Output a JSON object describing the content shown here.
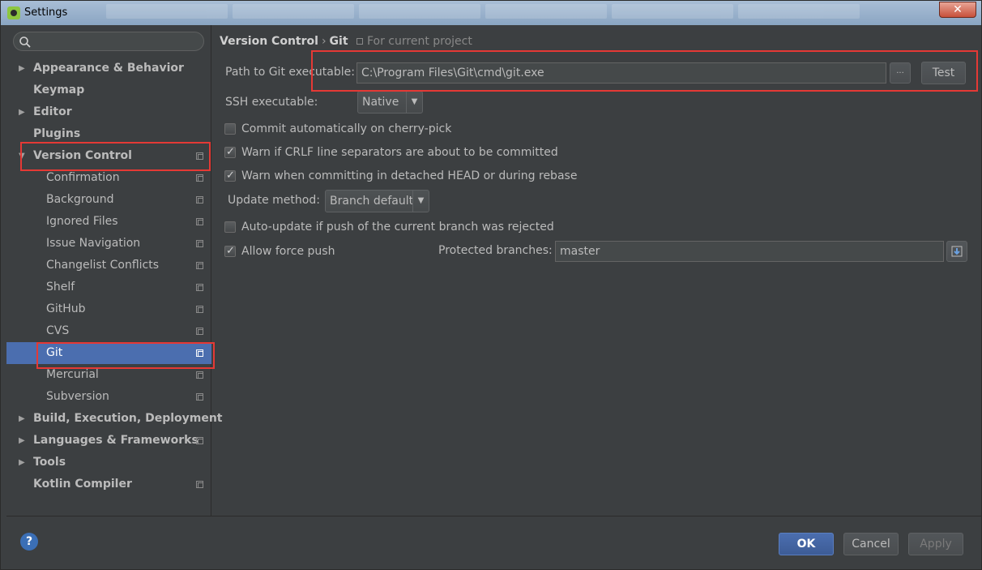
{
  "window": {
    "title": "Settings",
    "close_label": "✕"
  },
  "search": {
    "value": "",
    "placeholder": ""
  },
  "sidebar": {
    "items": [
      {
        "label": "Appearance & Behavior",
        "expandable": true,
        "expanded": false,
        "project": false
      },
      {
        "label": "Keymap",
        "expandable": false,
        "project": false
      },
      {
        "label": "Editor",
        "expandable": true,
        "expanded": false,
        "project": false
      },
      {
        "label": "Plugins",
        "expandable": false,
        "project": false
      },
      {
        "label": "Version Control",
        "expandable": true,
        "expanded": true,
        "project": true
      },
      {
        "label": "Confirmation",
        "child": true,
        "project": true
      },
      {
        "label": "Background",
        "child": true,
        "project": true
      },
      {
        "label": "Ignored Files",
        "child": true,
        "project": true
      },
      {
        "label": "Issue Navigation",
        "child": true,
        "project": true
      },
      {
        "label": "Changelist Conflicts",
        "child": true,
        "project": true
      },
      {
        "label": "Shelf",
        "child": true,
        "project": true
      },
      {
        "label": "GitHub",
        "child": true,
        "project": true
      },
      {
        "label": "CVS",
        "child": true,
        "project": true
      },
      {
        "label": "Git",
        "child": true,
        "project": true,
        "selected": true
      },
      {
        "label": "Mercurial",
        "child": true,
        "project": true
      },
      {
        "label": "Subversion",
        "child": true,
        "project": true
      },
      {
        "label": "Build, Execution, Deployment",
        "expandable": true,
        "expanded": false,
        "project": false
      },
      {
        "label": "Languages & Frameworks",
        "expandable": true,
        "expanded": false,
        "project": true
      },
      {
        "label": "Tools",
        "expandable": true,
        "expanded": false,
        "project": false
      },
      {
        "label": "Kotlin Compiler",
        "expandable": false,
        "project": true
      }
    ]
  },
  "breadcrumb": {
    "parent": "Version Control",
    "separator": "›",
    "current": "Git",
    "scope": "For current project"
  },
  "git": {
    "path_label": "Path to Git executable:",
    "path_value": "C:\\Program Files\\Git\\cmd\\git.exe",
    "browse_label": "...",
    "test_label": "Test",
    "ssh_label": "SSH executable:",
    "ssh_value": "Native",
    "commit_cherry": "Commit automatically on cherry-pick",
    "warn_crlf": "Warn if CRLF line separators are about to be committed",
    "warn_detached": "Warn when committing in detached HEAD or during rebase",
    "update_label": "Update method:",
    "update_value": "Branch default",
    "auto_update": "Auto-update if push of the current branch was rejected",
    "allow_force": "Allow force push",
    "protected_label": "Protected branches:",
    "protected_value": "master",
    "checks": {
      "commit_cherry": false,
      "warn_crlf": true,
      "warn_detached": true,
      "auto_update": false,
      "allow_force": true
    }
  },
  "footer": {
    "help": "?",
    "ok": "OK",
    "cancel": "Cancel",
    "apply": "Apply"
  },
  "colors": {
    "background": "#3c3f41",
    "selection": "#4b6eaf",
    "highlight": "#e53935"
  }
}
